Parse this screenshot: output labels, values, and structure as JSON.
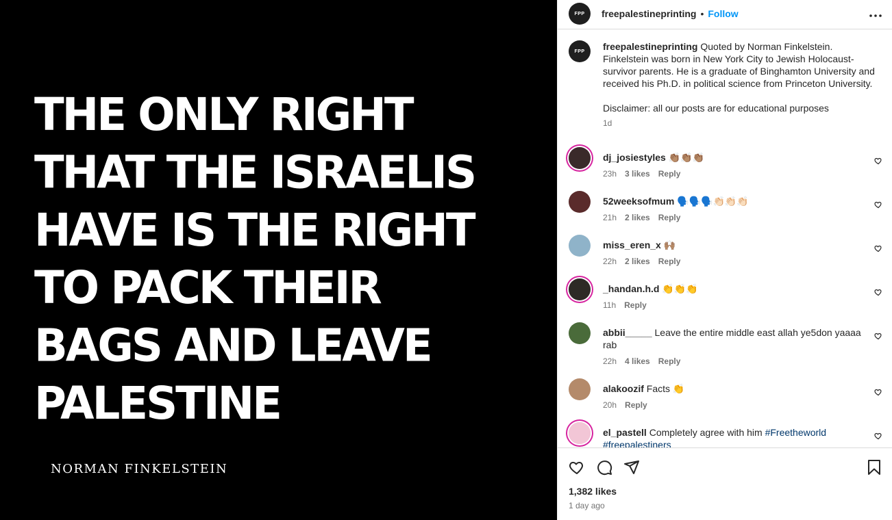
{
  "post": {
    "quote_lines": [
      "THE ONLY RIGHT",
      "THAT THE ISRAELIS",
      "HAVE IS THE RIGHT",
      "TO PACK THEIR",
      "BAGS AND LEAVE",
      "PALESTINE"
    ],
    "author": "NORMAN FINKELSTEIN"
  },
  "header": {
    "avatar_text": "FPP",
    "username": "freepalestineprinting",
    "separator": "•",
    "follow_label": "Follow",
    "more_icon": "more-horizontal-icon"
  },
  "caption": {
    "username": "freepalestineprinting",
    "text": "Quoted by Norman Finkelstein. Finkelstein was born in New York City to Jewish Holocaust-survivor parents. He is a graduate of Binghamton University and received his Ph.D. in political science from Princeton University.",
    "disclaimer": "Disclaimer: all our posts are for educational purposes",
    "time": "1d"
  },
  "comments": [
    {
      "username": "dj_josiestyles",
      "text": "👏🏽👏🏽👏🏽",
      "time": "23h",
      "likes": "3 likes",
      "reply": "Reply",
      "avatar_color": "#3a2a2a",
      "ring": true
    },
    {
      "username": "52weeksofmum",
      "text": "🗣️🗣️🗣️👏🏻👏🏻👏🏻",
      "time": "21h",
      "likes": "2 likes",
      "reply": "Reply",
      "avatar_color": "#5a2b2b",
      "ring": false
    },
    {
      "username": "miss_eren_x",
      "text": "🙌🏽",
      "time": "22h",
      "likes": "2 likes",
      "reply": "Reply",
      "avatar_color": "#8fb3c9",
      "ring": false
    },
    {
      "username": "_handan.h.d",
      "text": "👏👏👏",
      "time": "11h",
      "likes": "",
      "reply": "Reply",
      "avatar_color": "#2d2a26",
      "ring": true
    },
    {
      "username": "abbii_____",
      "text": "Leave the entire middle east allah ye5don yaaaa rab",
      "time": "22h",
      "likes": "4 likes",
      "reply": "Reply",
      "avatar_color": "#4a6b3a",
      "ring": false
    },
    {
      "username": "alakoozif",
      "text": "Facts 👏",
      "time": "20h",
      "likes": "",
      "reply": "Reply",
      "avatar_color": "#b48a6a",
      "ring": false
    },
    {
      "username": "el_pastell",
      "text": "Completely agree with him",
      "hashtags": "#Freetheworld #freepalestiners",
      "time": "",
      "likes": "",
      "reply": "",
      "avatar_color": "#f2c6d6",
      "ring": true
    }
  ],
  "actions": {
    "like_icon": "heart-icon",
    "comment_icon": "comment-icon",
    "share_icon": "share-icon",
    "save_icon": "bookmark-icon",
    "likes": "1,382 likes",
    "posted": "1 day ago"
  },
  "colors": {
    "accent": "#0095f6",
    "hashtag": "#00376b",
    "muted": "#737373",
    "ring": "#d6249f"
  }
}
